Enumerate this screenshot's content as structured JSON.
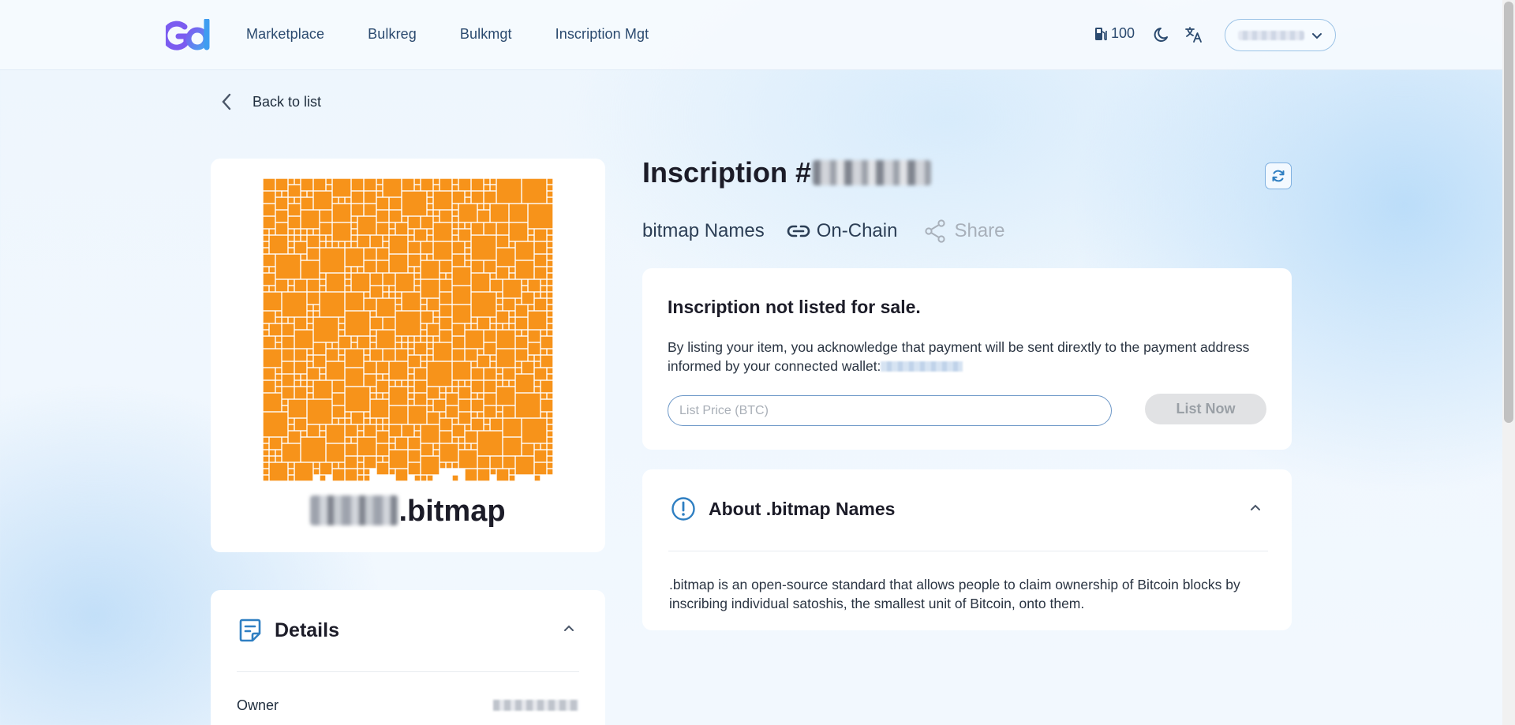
{
  "nav": {
    "items": [
      "Marketplace",
      "Bulkreg",
      "Bulkmgt",
      "Inscription Mgt"
    ]
  },
  "header": {
    "gas_value": "100"
  },
  "back_label": "Back to list",
  "inscription": {
    "title_prefix": "Inscription #",
    "name_suffix": ".bitmap",
    "collection": "bitmap Names",
    "onchain_label": "On-Chain",
    "share_label": "Share"
  },
  "sale": {
    "heading": "Inscription not listed for sale.",
    "description": "By listing your item, you acknowledge that payment will be sent dirextly to the payment address informed by your connected wallet:",
    "price_placeholder": "List Price (BTC)",
    "list_button": "List Now"
  },
  "about": {
    "title": "About .bitmap Names",
    "body": ".bitmap is an open-source standard that allows people to claim ownership of Bitcoin blocks by inscribing individual satoshis, the smallest unit of Bitcoin, onto them."
  },
  "details": {
    "title": "Details",
    "owner_label": "Owner"
  },
  "colors": {
    "accent": "#2f7fc2",
    "bitmap_orange": "#f7931a",
    "nav_text": "#2b4a6f"
  }
}
